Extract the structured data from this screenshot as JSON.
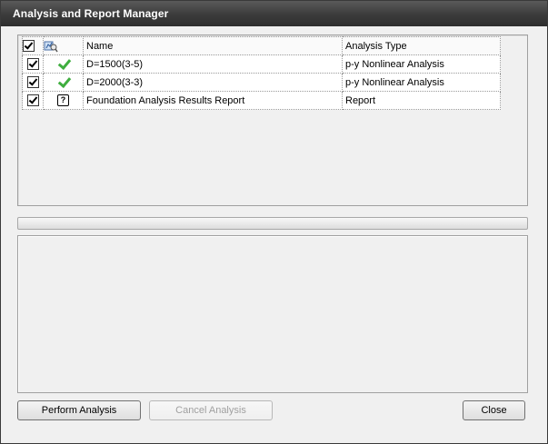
{
  "window": {
    "title": "Analysis and Report Manager"
  },
  "grid": {
    "headers": {
      "name": "Name",
      "type": "Analysis Type"
    },
    "rows": [
      {
        "checked": true,
        "status": "check-icon",
        "name": "D=1500(3-5)",
        "type": "p-y Nonlinear Analysis"
      },
      {
        "checked": true,
        "status": "check-icon",
        "name": "D=2000(3-3)",
        "type": "p-y Nonlinear Analysis"
      },
      {
        "checked": true,
        "status": "question-icon",
        "name": "Foundation Analysis Results Report",
        "type": "Report"
      }
    ]
  },
  "buttons": {
    "perform": "Perform Analysis",
    "cancel": "Cancel Analysis",
    "close": "Close"
  },
  "progress": {
    "value": 0
  }
}
